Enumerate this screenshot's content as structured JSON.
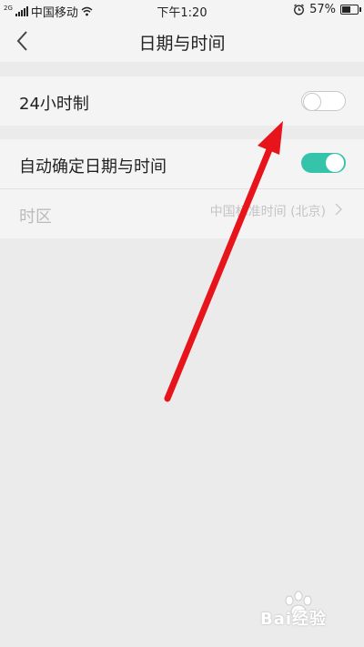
{
  "status_bar": {
    "network_tag": "2G",
    "carrier": "中国移动",
    "time": "下午1:20",
    "battery_percent": "57%",
    "battery_level": 0.57,
    "icons": [
      "signal-icon",
      "wifi-icon",
      "alarm-icon",
      "battery-icon"
    ]
  },
  "header": {
    "title": "日期与时间",
    "back_icon": "back-chevron-icon"
  },
  "settings": {
    "hour24": {
      "label": "24小时制",
      "enabled": false
    },
    "auto_time": {
      "label": "自动确定日期与时间",
      "enabled": true
    },
    "timezone": {
      "label": "时区",
      "value": "中国标准时间 (北京)",
      "disabled": true
    }
  },
  "colors": {
    "toggle_on": "#35c3a9",
    "annotation_arrow": "#e8141c",
    "background": "#ebebeb"
  },
  "watermark": {
    "text": "Bai经验"
  }
}
